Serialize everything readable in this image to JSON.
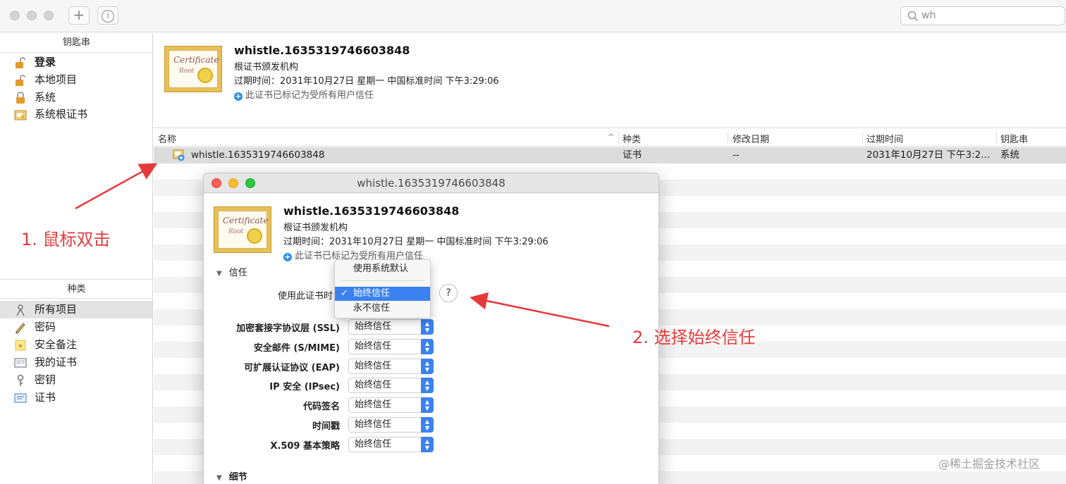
{
  "toolbar": {
    "add_glyph": "+",
    "info_glyph": "i",
    "search_value": "wh"
  },
  "sidebar": {
    "keychains_header": "钥匙串",
    "keychains": [
      {
        "label": "登录",
        "icon": "lock-open-icon",
        "bold": true
      },
      {
        "label": "本地项目",
        "icon": "lock-open-icon"
      },
      {
        "label": "系统",
        "icon": "lock-icon"
      },
      {
        "label": "系统根证书",
        "icon": "certificate-folder-icon"
      }
    ],
    "category_header": "种类",
    "categories": [
      {
        "label": "所有项目",
        "icon": "all-items-icon",
        "selected": true
      },
      {
        "label": "密码",
        "icon": "pencil-icon"
      },
      {
        "label": "安全备注",
        "icon": "note-icon"
      },
      {
        "label": "我的证书",
        "icon": "my-certificate-icon"
      },
      {
        "label": "密钥",
        "icon": "key-icon"
      },
      {
        "label": "证书",
        "icon": "certificate-icon"
      }
    ]
  },
  "header": {
    "cert_icon_text": "Certificate",
    "cert_icon_subtext": "Root",
    "title": "whistle.1635319746603848",
    "subtitle": "根证书颁发机构",
    "expiry": "过期时间：2031年10月27日 星期一 中国标准时间 下午3:29:06",
    "trust_note": "此证书已标记为受所有用户信任"
  },
  "table": {
    "columns": [
      "名称",
      "种类",
      "修改日期",
      "过期时间",
      "钥匙串"
    ],
    "sort_glyph": "^",
    "rows": [
      {
        "name": "whistle.1635319746603848",
        "kind": "证书",
        "modified": "--",
        "expires": "2031年10月27日 下午3:2...",
        "keychain": "系统"
      }
    ]
  },
  "dialog": {
    "title": "whistle.1635319746603848",
    "cert_title": "whistle.1635319746603848",
    "cert_subtitle": "根证书颁发机构",
    "cert_expiry": "过期时间：2031年10月27日 星期一 中国标准时间 下午3:29:06",
    "cert_trust_note": "此证书已标记为受所有用户信任",
    "trust_section": "信任",
    "when_using_label": "使用此证书时",
    "help_glyph": "?",
    "menu": {
      "options": [
        "使用系统默认",
        "始终信任",
        "永不信任"
      ],
      "selected": "始终信任",
      "check_glyph": "✓"
    },
    "policies": [
      {
        "label": "加密套接字协议层 (SSL)",
        "value": "始终信任"
      },
      {
        "label": "安全邮件 (S/MIME)",
        "value": "始终信任"
      },
      {
        "label": "可扩展认证协议 (EAP)",
        "value": "始终信任"
      },
      {
        "label": "IP 安全 (IPsec)",
        "value": "始终信任"
      },
      {
        "label": "代码签名",
        "value": "始终信任"
      },
      {
        "label": "时间戳",
        "value": "始终信任"
      },
      {
        "label": "X.509 基本策略",
        "value": "始终信任"
      }
    ],
    "details_section": "细节"
  },
  "annotations": {
    "step1": "1. 鼠标双击",
    "step2": "2. 选择始终信任",
    "color": "#e53a3a"
  },
  "watermark": "@稀土掘金技术社区",
  "colors": {
    "accent": "#3b82f0",
    "close": "#ff5f57",
    "minimize": "#febc2e",
    "zoom": "#28c840"
  }
}
